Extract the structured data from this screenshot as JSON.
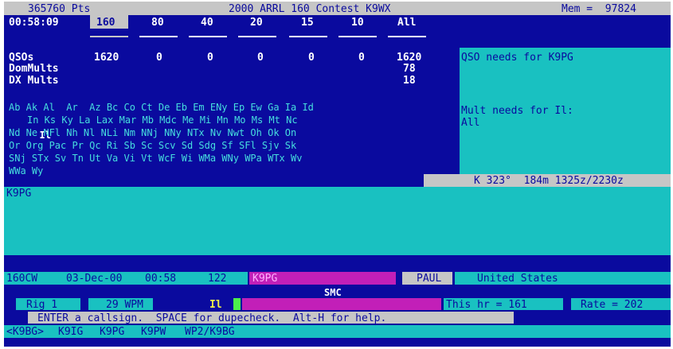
{
  "title_bar": {
    "points": "365760 Pts",
    "contest": "2000 ARRL 160 Contest K9WX",
    "mem": "Mem =  97824"
  },
  "bands_row": {
    "time": "00:58:09",
    "bands": [
      "160",
      "80",
      "40",
      "20",
      "15",
      "10",
      "All"
    ],
    "selected": "160"
  },
  "stats": {
    "qsos": {
      "label": "QSOs",
      "values": [
        "1620",
        "0",
        "0",
        "0",
        "0",
        "0",
        "1620"
      ]
    },
    "dom_mults": {
      "label": "DomMults",
      "total": "78"
    },
    "dx_mults": {
      "label": "DX Mults",
      "total": "18"
    }
  },
  "qso_needs": {
    "label": "QSO needs for K9PG"
  },
  "mult_needs": {
    "label": "Mult needs for Il:",
    "value": "All"
  },
  "mult_grid": {
    "rows": [
      "Ab Ak Al  Ar  Az Bc Co Ct De Eb Em ENy Ep Ew Ga Ia Id",
      "Il In Ks Ky La Lax Mar Mb Mdc Me Mi Mn Mo Ms Mt Nc",
      "Nd Ne NFl Nh Nl NLi Nm NNj NNy NTx Nv Nwt Oh Ok On",
      "Or Org Pac Pr Qc Ri Sb Sc Scv Sd Sdg Sf SFl Sjv Sk",
      "SNj STx Sv Tn Ut Va Vi Vt WcF Wi WMa WNy WPa WTx Wv",
      "WWa Wy"
    ],
    "highlighted": "Il"
  },
  "beam": {
    "text": "K 323°  184m 1325z/2230z"
  },
  "call_window": {
    "call": "K9PG"
  },
  "status_line": {
    "band_mode": "160CW",
    "date": "03-Dec-00",
    "time": "00:58",
    "number": "122",
    "call": "K9PG",
    "name": "PAUL",
    "country": "United States"
  },
  "section": {
    "value": "SMC"
  },
  "rig_line": {
    "rig": "Rig 1",
    "wpm": "29 WPM",
    "mult": "Il",
    "this_hr": "This hr = 161",
    "rate": "Rate = 202"
  },
  "help_line": {
    "text": "ENTER a callsign.  SPACE for dupecheck.  Alt-H for help."
  },
  "partials": {
    "items": [
      "<K9BG>",
      "K9IG",
      "K9PG",
      "K9PW",
      "WP2/K9BG"
    ]
  },
  "colors": {
    "background": "#0a0a9e",
    "gray_bar": "#c6c6c6",
    "cyan": "#19c1c1",
    "magenta": "#c21fb8",
    "green": "#4cf04c",
    "mult_text": "#46dede"
  }
}
